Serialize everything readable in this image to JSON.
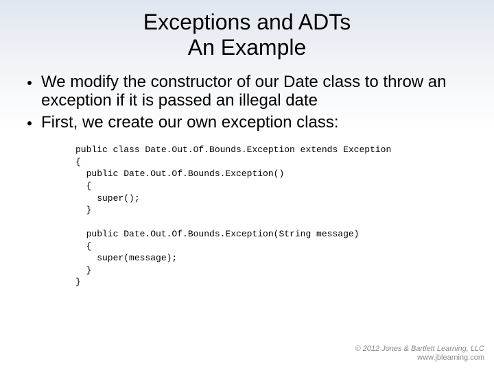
{
  "title_line1": "Exceptions and ADTs",
  "title_line2": "An Example",
  "bullets": [
    "We modify the constructor of our Date class to throw an exception if it is passed an illegal date",
    "First, we create our own exception class:"
  ],
  "code": "public class Date.Out.Of.Bounds.Exception extends Exception\n{\n  public Date.Out.Of.Bounds.Exception()\n  {\n    super();\n  }\n\n  public Date.Out.Of.Bounds.Exception(String message)\n  {\n    super(message);\n  }\n}",
  "footer_line1": "© 2012 Jones & Bartlett Learning, LLC",
  "footer_line2": "www.jblearning.com"
}
